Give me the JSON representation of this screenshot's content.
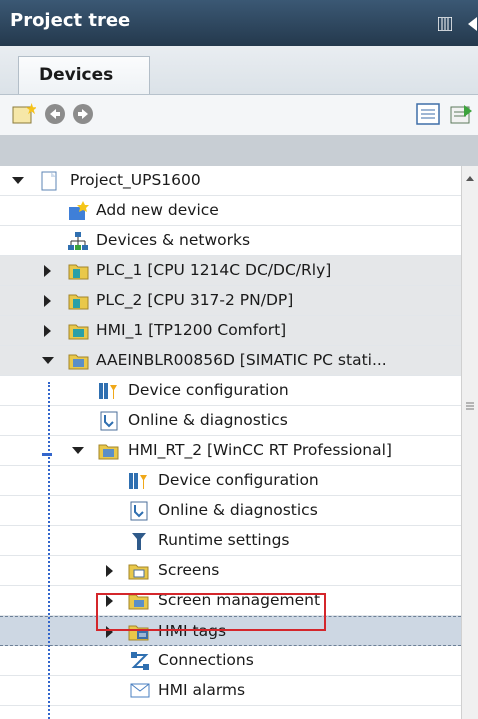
{
  "panel": {
    "title": "Project tree"
  },
  "tabs": [
    {
      "label": "Devices",
      "active": true
    }
  ],
  "tree": {
    "items": [
      {
        "label": "Project_UPS1600"
      },
      {
        "label": "Add new device"
      },
      {
        "label": "Devices & networks"
      },
      {
        "label": "PLC_1 [CPU 1214C DC/DC/Rly]"
      },
      {
        "label": "PLC_2 [CPU 317-2 PN/DP]"
      },
      {
        "label": "HMI_1 [TP1200 Comfort]"
      },
      {
        "label": "AAEINBLR00856D [SIMATIC PC stati..."
      },
      {
        "label": "Device configuration"
      },
      {
        "label": "Online & diagnostics"
      },
      {
        "label": "HMI_RT_2 [WinCC RT Professional]"
      },
      {
        "label": "Device configuration"
      },
      {
        "label": "Online & diagnostics"
      },
      {
        "label": "Runtime settings"
      },
      {
        "label": "Screens"
      },
      {
        "label": "Screen management"
      },
      {
        "label": "HMI tags",
        "selected": true,
        "highlighted": true
      },
      {
        "label": "Connections"
      },
      {
        "label": "HMI alarms"
      }
    ]
  },
  "colors": {
    "title_bar": "#2e4760",
    "selection": "#cdd7e3",
    "highlight_box": "#d4262b"
  }
}
